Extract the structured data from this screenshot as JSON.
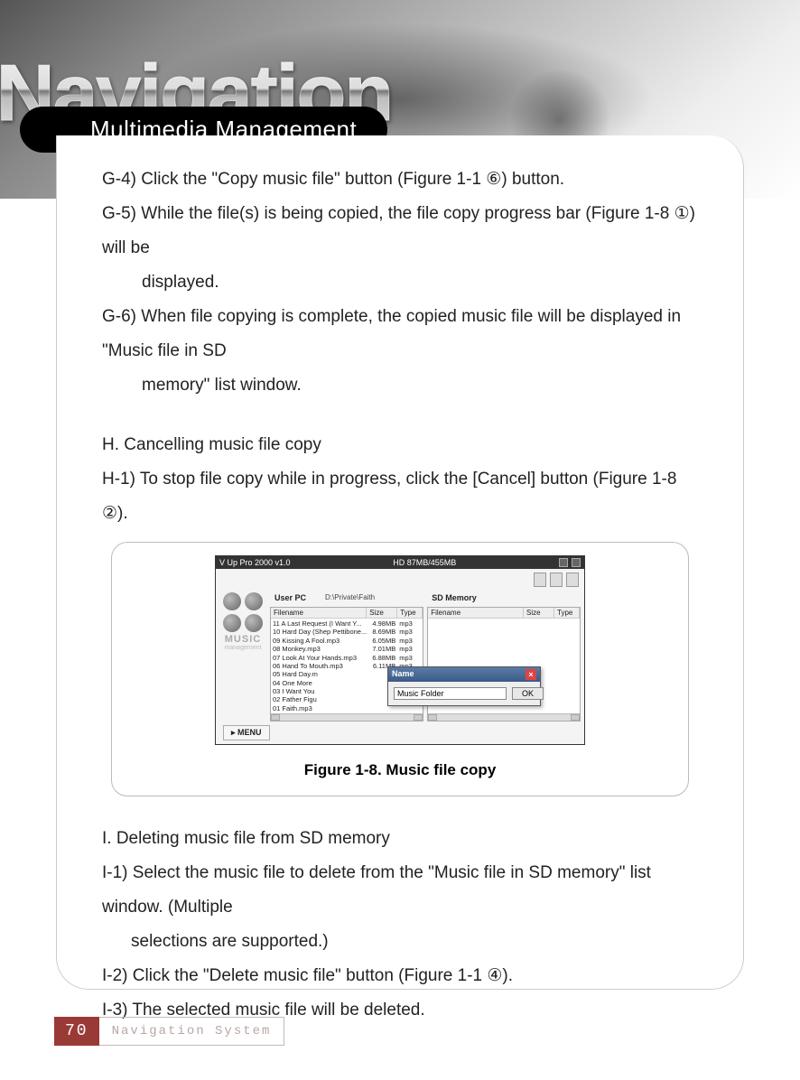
{
  "header": {
    "bg_title": "Navigation",
    "section_tab": "Multimedia Management"
  },
  "body": {
    "g4": "G-4) Click the \"Copy music file\" button (Figure 1-1 ⑥) button.",
    "g5a": "G-5) While the file(s) is being copied, the file copy progress bar (Figure 1-8 ①) will be",
    "g5b": "displayed.",
    "g6a": "G-6) When file copying is complete, the copied music file will be displayed in \"Music file in SD",
    "g6b": "memory\" list window.",
    "h_head": "H. Cancelling music file copy",
    "h1": "H-1) To stop file copy while in progress, click the [Cancel] button (Figure 1-8 ②).",
    "i_head": "I. Deleting music file from SD memory",
    "i1a": "I-1) Select the music file to delete from the \"Music file in SD memory\" list window. (Multiple",
    "i1b": "selections are supported.)",
    "i2": "I-2) Click the \"Delete music file\" button (Figure 1-1 ④).",
    "i3": "I-3) The selected music file will be deleted."
  },
  "figure": {
    "caption": "Figure 1-8. Music file copy",
    "app_title": "V Up Pro 2000  v1.0",
    "app_title_center": "HD          87MB/455MB",
    "logo_text": "MUSIC",
    "logo_sub": "management",
    "left_pane_label": "User PC",
    "left_pane_path": "D:\\Private\\Faith",
    "right_pane_label": "SD Memory",
    "cols": {
      "filename": "Filename",
      "size": "Size",
      "type": "Type"
    },
    "files": [
      {
        "name": "11 A Last Request (I Want Y...",
        "size": "4.98MB",
        "type": "mp3"
      },
      {
        "name": "10 Hard Day (Shep Pettibone...",
        "size": "8.69MB",
        "type": "mp3"
      },
      {
        "name": "09 Kissing A Fool.mp3",
        "size": "6.05MB",
        "type": "mp3"
      },
      {
        "name": "08 Monkey.mp3",
        "size": "7.01MB",
        "type": "mp3"
      },
      {
        "name": "07 Look At Your Hands.mp3",
        "size": "6.88MB",
        "type": "mp3"
      },
      {
        "name": "06 Hand To Mouth.mp3",
        "size": "6.11MB",
        "type": "mp3"
      },
      {
        "name": "05 Hard Day.m",
        "size": "",
        "type": ""
      },
      {
        "name": "04 One More",
        "size": "",
        "type": ""
      },
      {
        "name": "03 I Want You",
        "size": "",
        "type": ""
      },
      {
        "name": "02 Father Figu",
        "size": "",
        "type": ""
      },
      {
        "name": "01 Faith.mp3",
        "size": "",
        "type": ""
      }
    ],
    "dialog": {
      "title": "Name",
      "input_value": "Music Folder",
      "ok_label": "OK"
    },
    "menu_label": "MENU"
  },
  "footer": {
    "page": "70",
    "label": "Navigation System"
  }
}
